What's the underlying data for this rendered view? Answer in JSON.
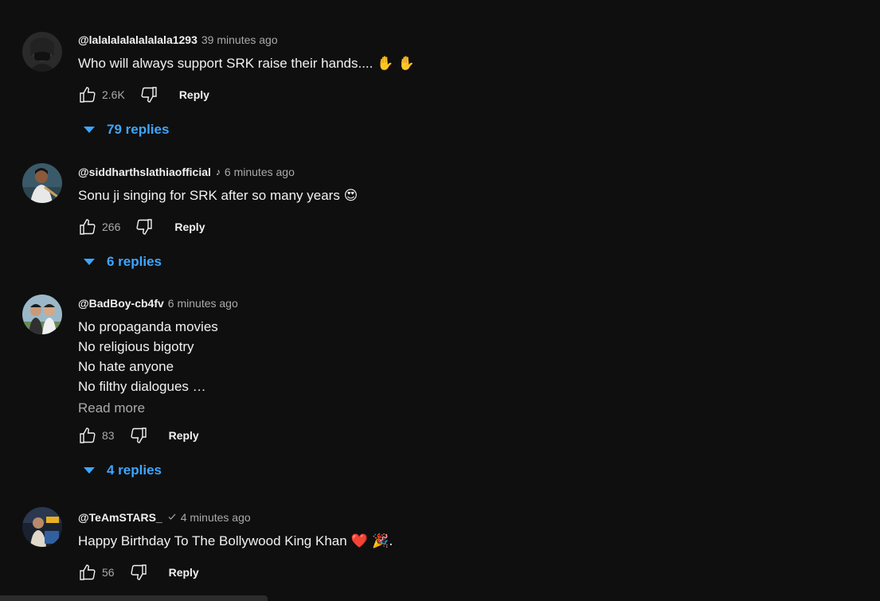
{
  "colors": {
    "background": "#0f0f0f",
    "text": "#f1f1f1",
    "secondary": "#aaaaaa",
    "link": "#3ea6ff"
  },
  "comments": [
    {
      "author": "@lalalalalalalalala1293",
      "time": "39 minutes ago",
      "text_lines": [
        "Who will always support SRK raise their hands...."
      ],
      "emoji": "✋ ✋",
      "likes": "2.6K",
      "reply_label": "Reply",
      "replies_label": "79 replies"
    },
    {
      "author": "@siddharthslathiaofficial",
      "badge_icon": "music-note-icon",
      "time": "6 minutes ago",
      "text_lines": [
        "Sonu ji singing for SRK after so many years"
      ],
      "emoji": "😍",
      "likes": "266",
      "reply_label": "Reply",
      "replies_label": "6 replies"
    },
    {
      "author": "@BadBoy-cb4fv",
      "time": "6 minutes ago",
      "text_lines": [
        "No propaganda movies",
        "No religious bigotry",
        "No hate anyone",
        "No filthy dialogues …"
      ],
      "read_more": "Read more",
      "likes": "83",
      "reply_label": "Reply",
      "replies_label": "4 replies"
    },
    {
      "author": "@TeAmSTARS_",
      "badge_icon": "verified-check-icon",
      "time": "4 minutes ago",
      "text_lines": [
        "Happy Birthday To The Bollywood King Khan"
      ],
      "emoji": "❤️ 🎉.",
      "likes": "56",
      "reply_label": "Reply"
    }
  ]
}
